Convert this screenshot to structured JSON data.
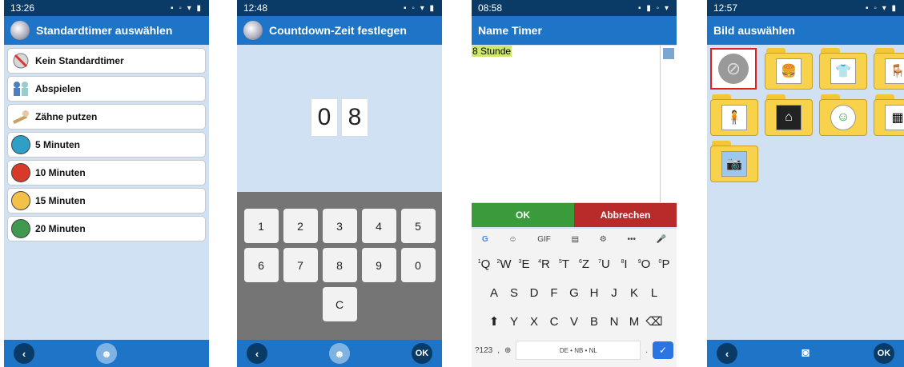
{
  "screen1": {
    "time": "13:26",
    "title": "Standardtimer auswählen",
    "items": [
      {
        "label": "Kein Standardtimer",
        "icon": "no-timer-icon",
        "color": ""
      },
      {
        "label": "Abspielen",
        "icon": "play-people-icon",
        "color": ""
      },
      {
        "label": "Zähne putzen",
        "icon": "toothbrush-icon",
        "color": ""
      },
      {
        "label": "5 Minuten",
        "icon": "circle-icon",
        "color": "#2e9fc7"
      },
      {
        "label": "10 Minuten",
        "icon": "circle-icon",
        "color": "#d83a2a"
      },
      {
        "label": "15 Minuten",
        "icon": "circle-icon",
        "color": "#f3c14a"
      },
      {
        "label": "20 Minuten",
        "icon": "circle-icon",
        "color": "#3f9a4e"
      }
    ]
  },
  "screen2": {
    "time": "12:48",
    "title": "Countdown-Zeit festlegen",
    "digits": [
      "0",
      "8"
    ],
    "keys_row1": [
      "1",
      "2",
      "3",
      "4",
      "5"
    ],
    "keys_row2": [
      "6",
      "7",
      "8",
      "9",
      "0"
    ],
    "key_clear": "C",
    "ok": "OK"
  },
  "screen3": {
    "time": "08:58",
    "title": "Name Timer",
    "text_value": "8 Stunde",
    "ok": "OK",
    "cancel": "Abbrechen",
    "toolbar": [
      "G",
      "☺",
      "GIF",
      "▤",
      "⚙",
      "•••",
      "🎤"
    ],
    "row1": [
      "Q",
      "W",
      "E",
      "R",
      "T",
      "Z",
      "U",
      "I",
      "O",
      "P"
    ],
    "row1_sup": [
      "1",
      "2",
      "3",
      "4",
      "5",
      "6",
      "7",
      "8",
      "9",
      "0"
    ],
    "row2": [
      "A",
      "S",
      "D",
      "F",
      "G",
      "H",
      "J",
      "K",
      "L"
    ],
    "row3": [
      "Y",
      "X",
      "C",
      "V",
      "B",
      "N",
      "M"
    ],
    "sym_key": "?123",
    "space_label": "DE • NB • NL"
  },
  "screen4": {
    "time": "12:57",
    "title": "Bild auswählen",
    "ok": "OK"
  }
}
